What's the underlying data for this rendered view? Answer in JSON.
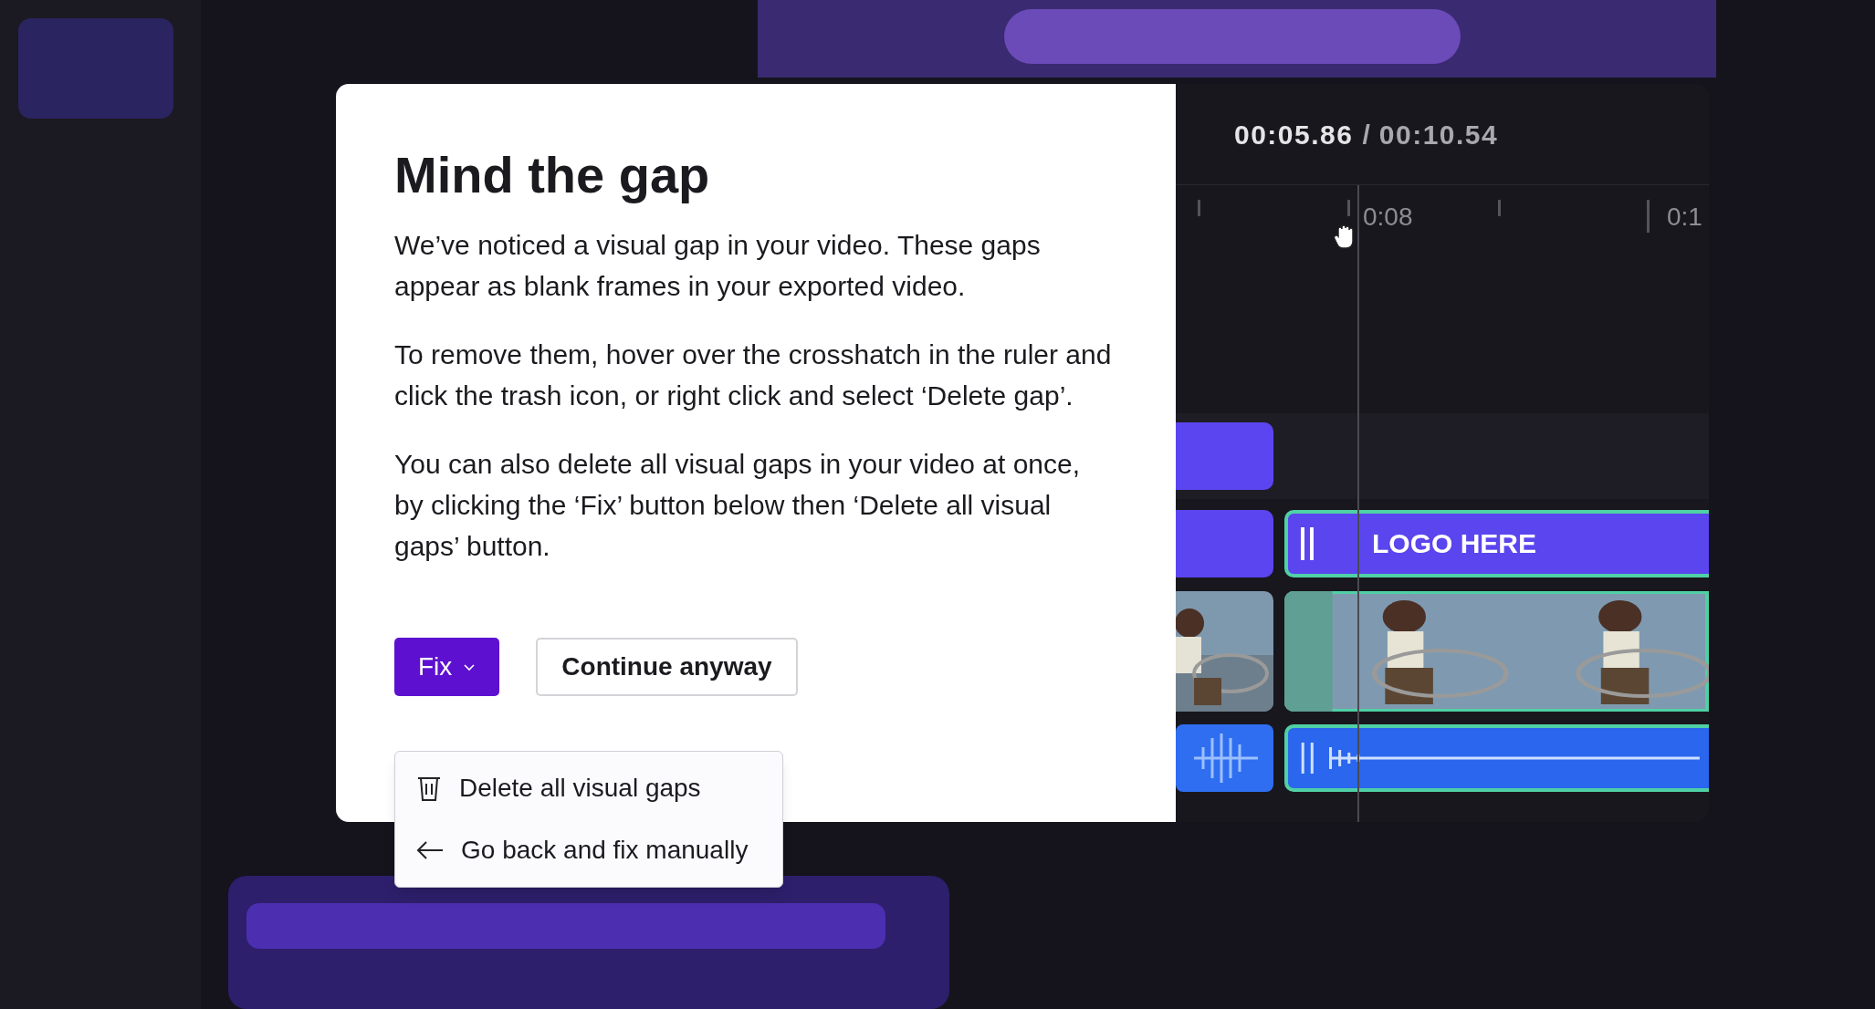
{
  "dialog": {
    "title": "Mind the gap",
    "paragraphs": [
      "We’ve noticed a visual gap in your video. These gaps appear as blank frames in your exported video.",
      "To remove them, hover over the crosshatch in the ruler and click the trash icon, or right click and select ‘Delete gap’.",
      "You can also delete all visual gaps in your video at once, by clicking the ‘Fix’ button below then ‘Delete all visual gaps’ button."
    ],
    "fix_button": {
      "label": "Fix",
      "expanded": true
    },
    "continue_button": {
      "label": "Continue anyway"
    },
    "menu": [
      {
        "kind": "delete",
        "label": "Delete all visual gaps"
      },
      {
        "kind": "back",
        "label": "Go back and fix manually"
      }
    ]
  },
  "timeline": {
    "current_time": "00:05.86",
    "separator": "/",
    "total_time": "00:10.54",
    "ruler_labels": [
      "0:08",
      "0:1"
    ],
    "text_clip": "LOGO HERE"
  }
}
